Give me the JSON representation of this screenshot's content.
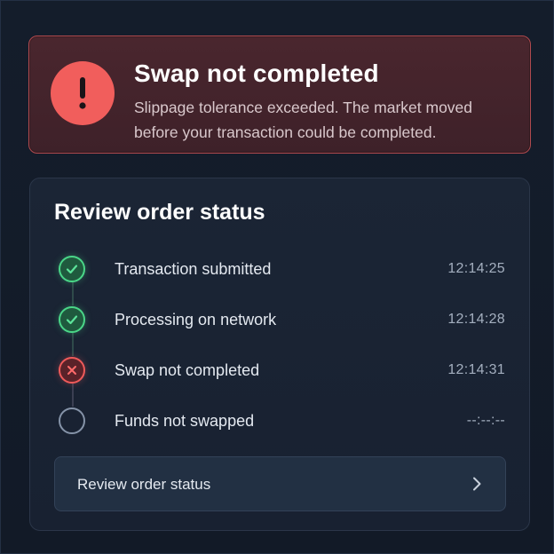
{
  "alert": {
    "icon": "exclamation-icon",
    "title": "Swap not completed",
    "message": "Slippage tolerance exceeded. The market moved before your transaction could be completed.",
    "accent_color": "#f15e5c"
  },
  "card": {
    "title": "Review order status",
    "steps": [
      {
        "label": "Transaction submitted",
        "time": "12:14:25",
        "status": "done",
        "icon": "check-circle-icon"
      },
      {
        "label": "Processing on network",
        "time": "12:14:28",
        "status": "done",
        "icon": "check-circle-icon"
      },
      {
        "label": "Swap not completed",
        "time": "12:14:31",
        "status": "failed",
        "icon": "x-circle-icon"
      },
      {
        "label": "Funds not swapped",
        "time": "--:--:--",
        "status": "pending",
        "icon": "empty-circle-icon"
      }
    ],
    "button": {
      "label": "Review order status",
      "icon": "chevron-right-icon"
    }
  },
  "colors": {
    "success": "#4ad688",
    "error": "#ef5a5a",
    "pending": "#8593a8",
    "background": "#131c2a"
  }
}
